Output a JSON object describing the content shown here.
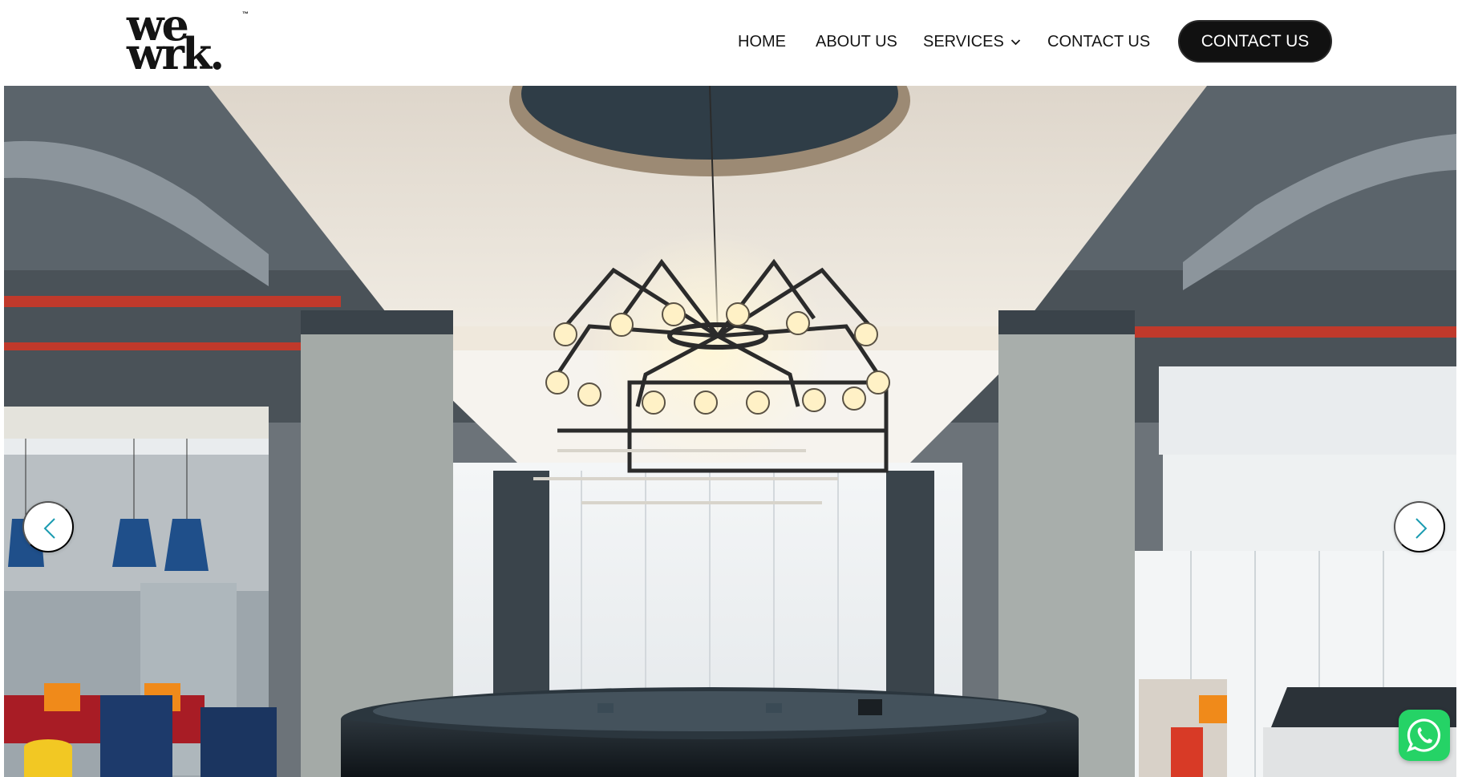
{
  "brand": {
    "logo_line1": "we",
    "logo_line2": "wrk.",
    "logo_trademark": "™"
  },
  "nav": {
    "items": [
      {
        "label": "HOME"
      },
      {
        "label": "ABOUT US"
      },
      {
        "label": "SERVICES",
        "has_dropdown": true
      },
      {
        "label": "CONTACT US"
      }
    ],
    "cta_label": "CONTACT US"
  },
  "hero": {
    "image_subject": "coworking-lounge-chandelier",
    "prev_icon": "chevron-left-icon",
    "next_icon": "chevron-right-icon"
  },
  "floating": {
    "whatsapp_icon": "whatsapp-icon"
  },
  "colors": {
    "accent_teal": "#1a9bb0",
    "cta_background": "#111111",
    "whatsapp_green": "#25d366"
  }
}
